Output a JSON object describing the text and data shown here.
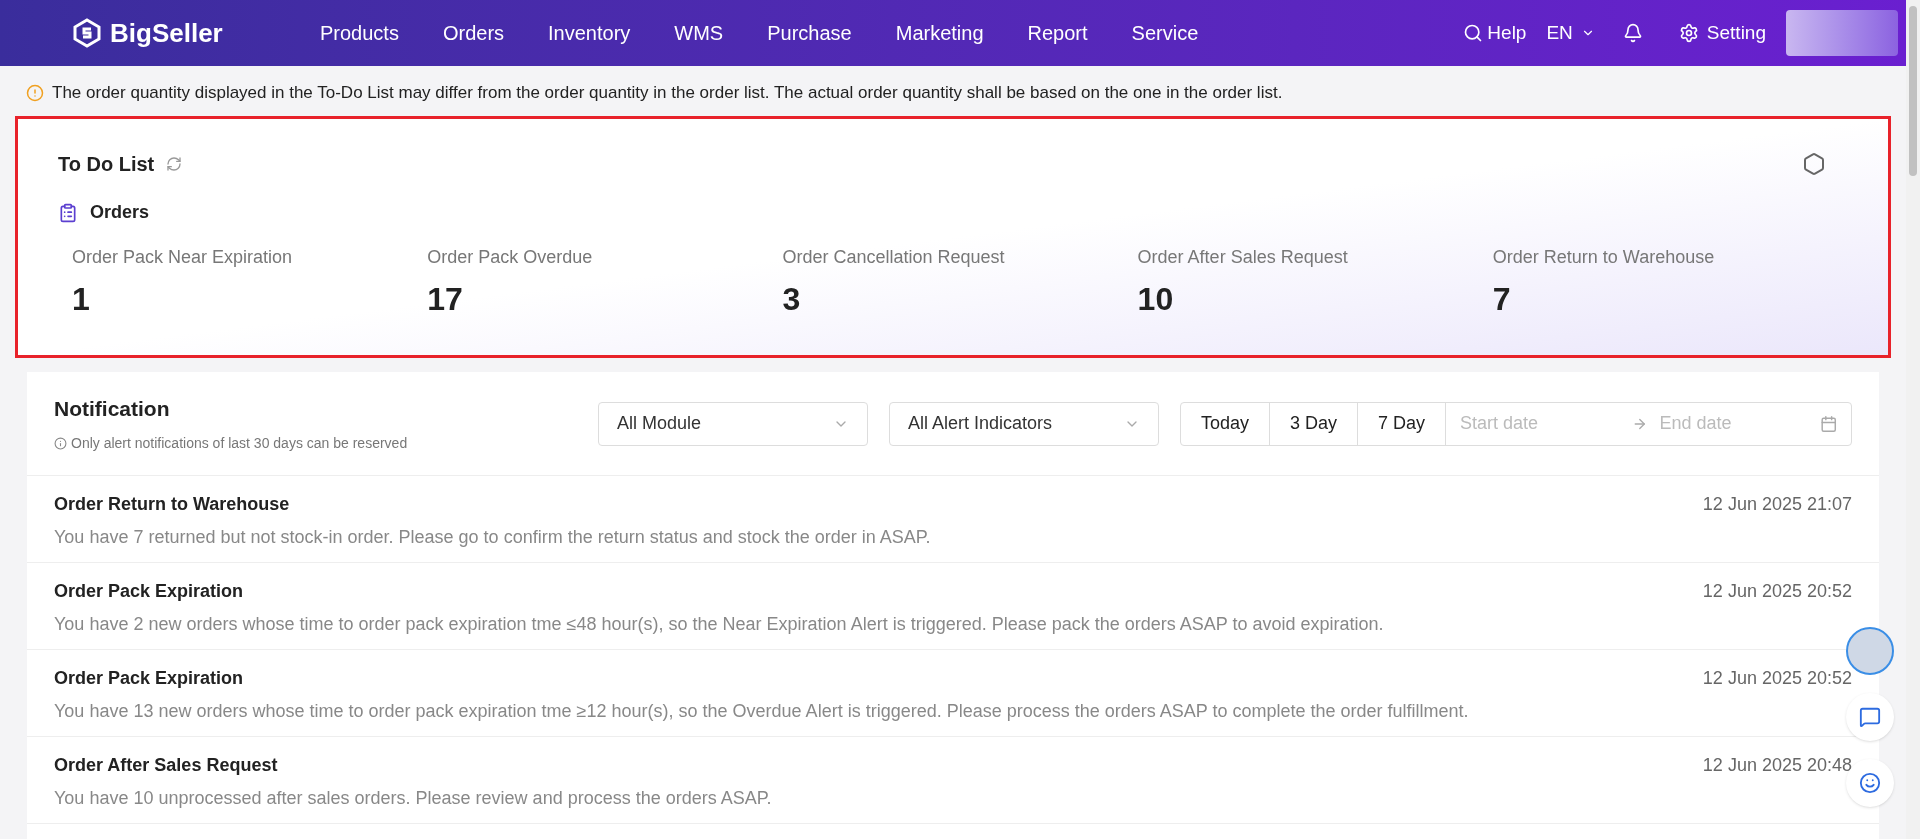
{
  "nav": {
    "logo": "BigSeller",
    "items": [
      "Products",
      "Orders",
      "Inventory",
      "WMS",
      "Purchase",
      "Marketing",
      "Report",
      "Service"
    ],
    "help": "Help",
    "language": "EN",
    "setting": "Setting"
  },
  "notice": "The order quantity displayed in the To-Do List may differ from the order quantity in the order list. The actual order quantity shall be based on the one in the order list.",
  "todo": {
    "title": "To Do List",
    "section": "Orders",
    "metrics": [
      {
        "label": "Order Pack Near Expiration",
        "value": "1"
      },
      {
        "label": "Order Pack Overdue",
        "value": "17"
      },
      {
        "label": "Order Cancellation Request",
        "value": "3"
      },
      {
        "label": "Order After Sales Request",
        "value": "10"
      },
      {
        "label": "Order Return to Warehouse",
        "value": "7"
      }
    ]
  },
  "notification": {
    "title": "Notification",
    "hint": "Only alert notifications of last 30 days can be reserved",
    "module_filter": "All Module",
    "alert_filter": "All Alert Indicators",
    "ranges": [
      "Today",
      "3 Day",
      "7 Day"
    ],
    "start_placeholder": "Start date",
    "end_placeholder": "End date",
    "items": [
      {
        "title": "Order Return to Warehouse",
        "time": "12 Jun 2025 21:07",
        "message": "You have 7 returned but not stock-in order. Please go to confirm the return status and stock the order in ASAP."
      },
      {
        "title": "Order Pack Expiration",
        "time": "12 Jun 2025 20:52",
        "message": "You have 2 new orders whose time to order pack expiration tme ≤48 hour(s), so the Near Expiration Alert is triggered. Please pack the orders ASAP to avoid expiration."
      },
      {
        "title": "Order Pack Expiration",
        "time": "12 Jun 2025 20:52",
        "message": "You have 13 new orders whose time to order pack expiration tme ≥12 hour(s), so the Overdue Alert is triggered. Please process the orders ASAP to complete the order fulfillment."
      },
      {
        "title": "Order After Sales Request",
        "time": "12 Jun 2025 20:48",
        "message": "You have 10 unprocessed after sales orders. Please review and process the orders ASAP."
      }
    ]
  }
}
